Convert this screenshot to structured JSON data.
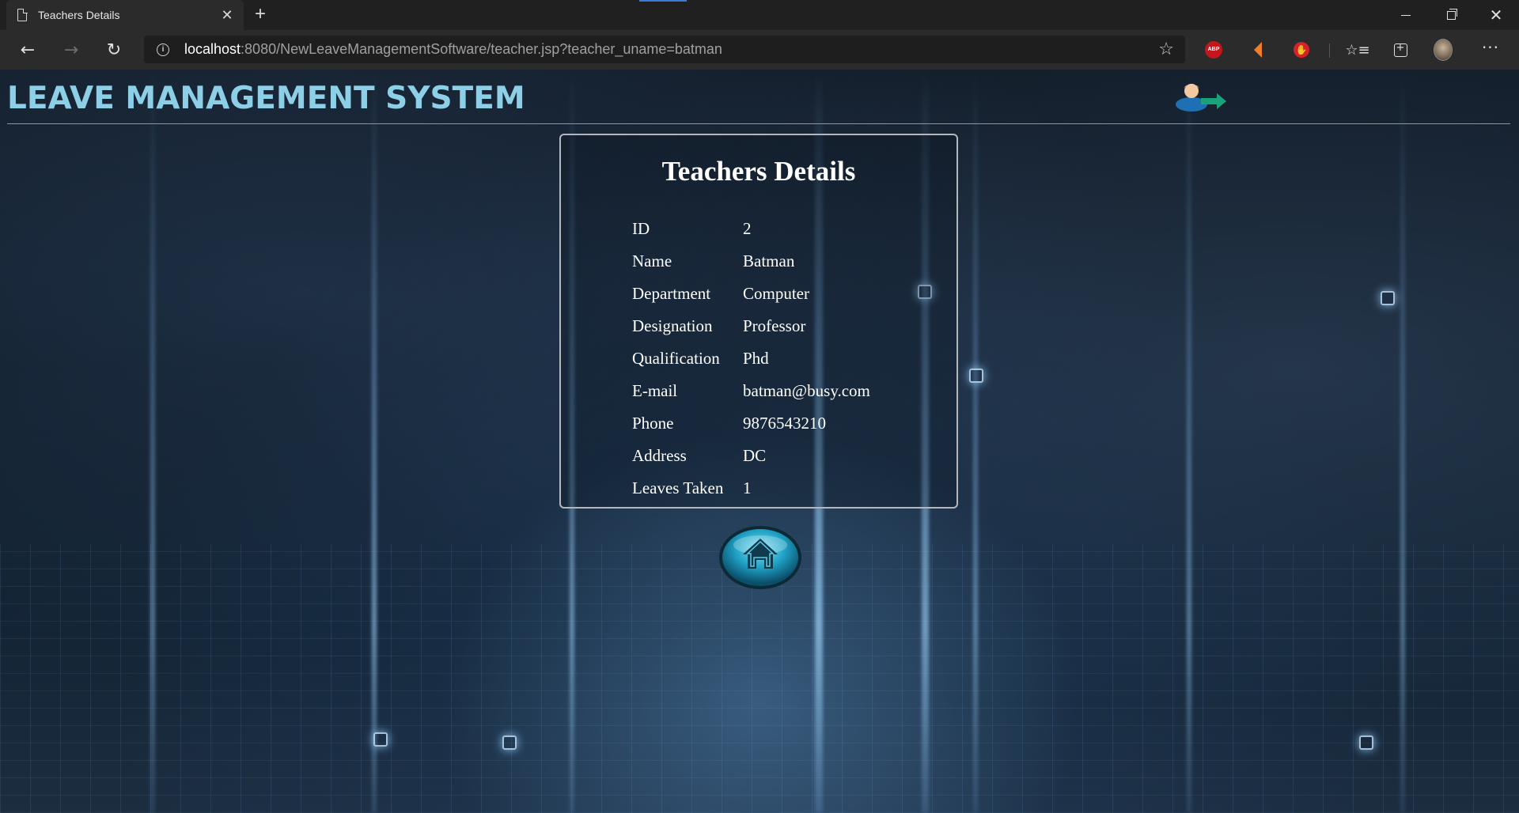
{
  "browser": {
    "tab_title": "Teachers Details",
    "tab_close": "✕",
    "new_tab": "+",
    "url_host": "localhost",
    "url_rest": ":8080/NewLeaveManagementSoftware/teacher.jsp?teacher_uname=batman",
    "back": "←",
    "forward": "→",
    "reload": "↻",
    "star": "☆",
    "abp_label": "ABP",
    "favorites": "☆≡",
    "more": "···",
    "close_window": "✕"
  },
  "header": {
    "title": "LEAVE MANAGEMENT SYSTEM"
  },
  "details": {
    "heading": "Teachers Details",
    "rows": [
      {
        "label": "ID",
        "value": "2"
      },
      {
        "label": "Name",
        "value": "Batman"
      },
      {
        "label": "Department",
        "value": "Computer"
      },
      {
        "label": "Designation",
        "value": "Professor"
      },
      {
        "label": "Qualification",
        "value": "Phd"
      },
      {
        "label": "E-mail",
        "value": "batman@busy.com"
      },
      {
        "label": "Phone",
        "value": "9876543210"
      },
      {
        "label": "Address",
        "value": "DC"
      },
      {
        "label": "Leaves Taken",
        "value": "1"
      }
    ]
  },
  "icons": {
    "logout": "logout-icon",
    "home": "home-icon"
  },
  "colors": {
    "title": "#8ccfe6",
    "panel_border": "#b4b8bd",
    "text": "#ffffff",
    "home_button": "#2aa0c0"
  }
}
